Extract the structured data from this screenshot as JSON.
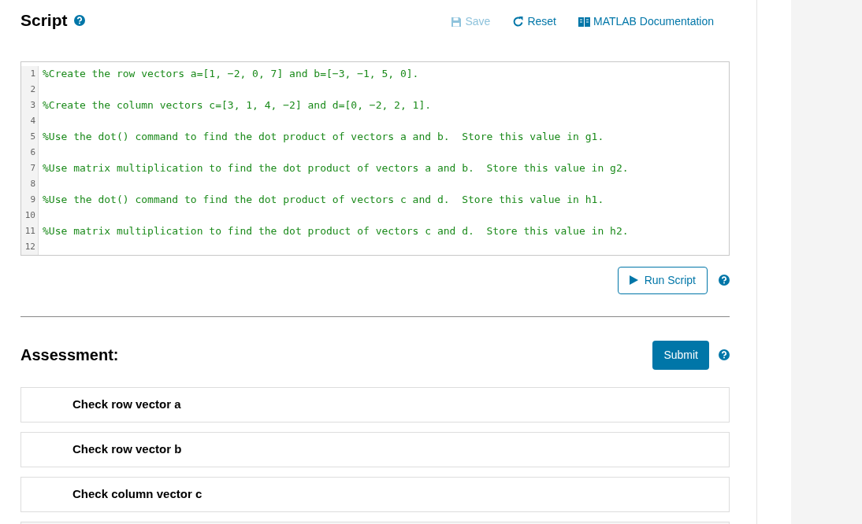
{
  "script": {
    "title": "Script",
    "help": true,
    "actions": [
      {
        "kind": "save",
        "label": "Save",
        "disabled": true
      },
      {
        "kind": "reset",
        "label": "Reset",
        "disabled": false
      },
      {
        "kind": "docs",
        "label": "MATLAB Documentation",
        "disabled": false
      }
    ],
    "code_lines": [
      {
        "number": "1",
        "text": "%Create the row vectors a=[1, −2, 0, 7] and b=[−3, −1, 5, 0]."
      },
      {
        "number": "2"
      },
      {
        "number": "3",
        "text": "%Create the column vectors c=[3, 1, 4, −2] and d=[0, −2, 2, 1]."
      },
      {
        "number": "4"
      },
      {
        "number": "5",
        "text": "%Use the dot() command to find the dot product of vectors a and b.  Store this value in g1."
      },
      {
        "number": "6"
      },
      {
        "number": "7",
        "text": "%Use matrix multiplication to find the dot product of vectors a and b.  Store this value in g2."
      },
      {
        "number": "8"
      },
      {
        "number": "9",
        "text": "%Use the dot() command to find the dot product of vectors c and d.  Store this value in h1."
      },
      {
        "number": "10"
      },
      {
        "number": "11",
        "text": "%Use matrix multiplication to find the dot product of vectors c and d.  Store this value in h2."
      },
      {
        "number": "12"
      }
    ],
    "run_button": "Run Script"
  },
  "assessment": {
    "title": "Assessment:",
    "submit_button": "Submit",
    "checks": [
      {
        "label": "Check row vector a"
      },
      {
        "label": "Check row vector b"
      },
      {
        "label": "Check column vector c"
      },
      {
        "kind": "cut"
      }
    ]
  }
}
